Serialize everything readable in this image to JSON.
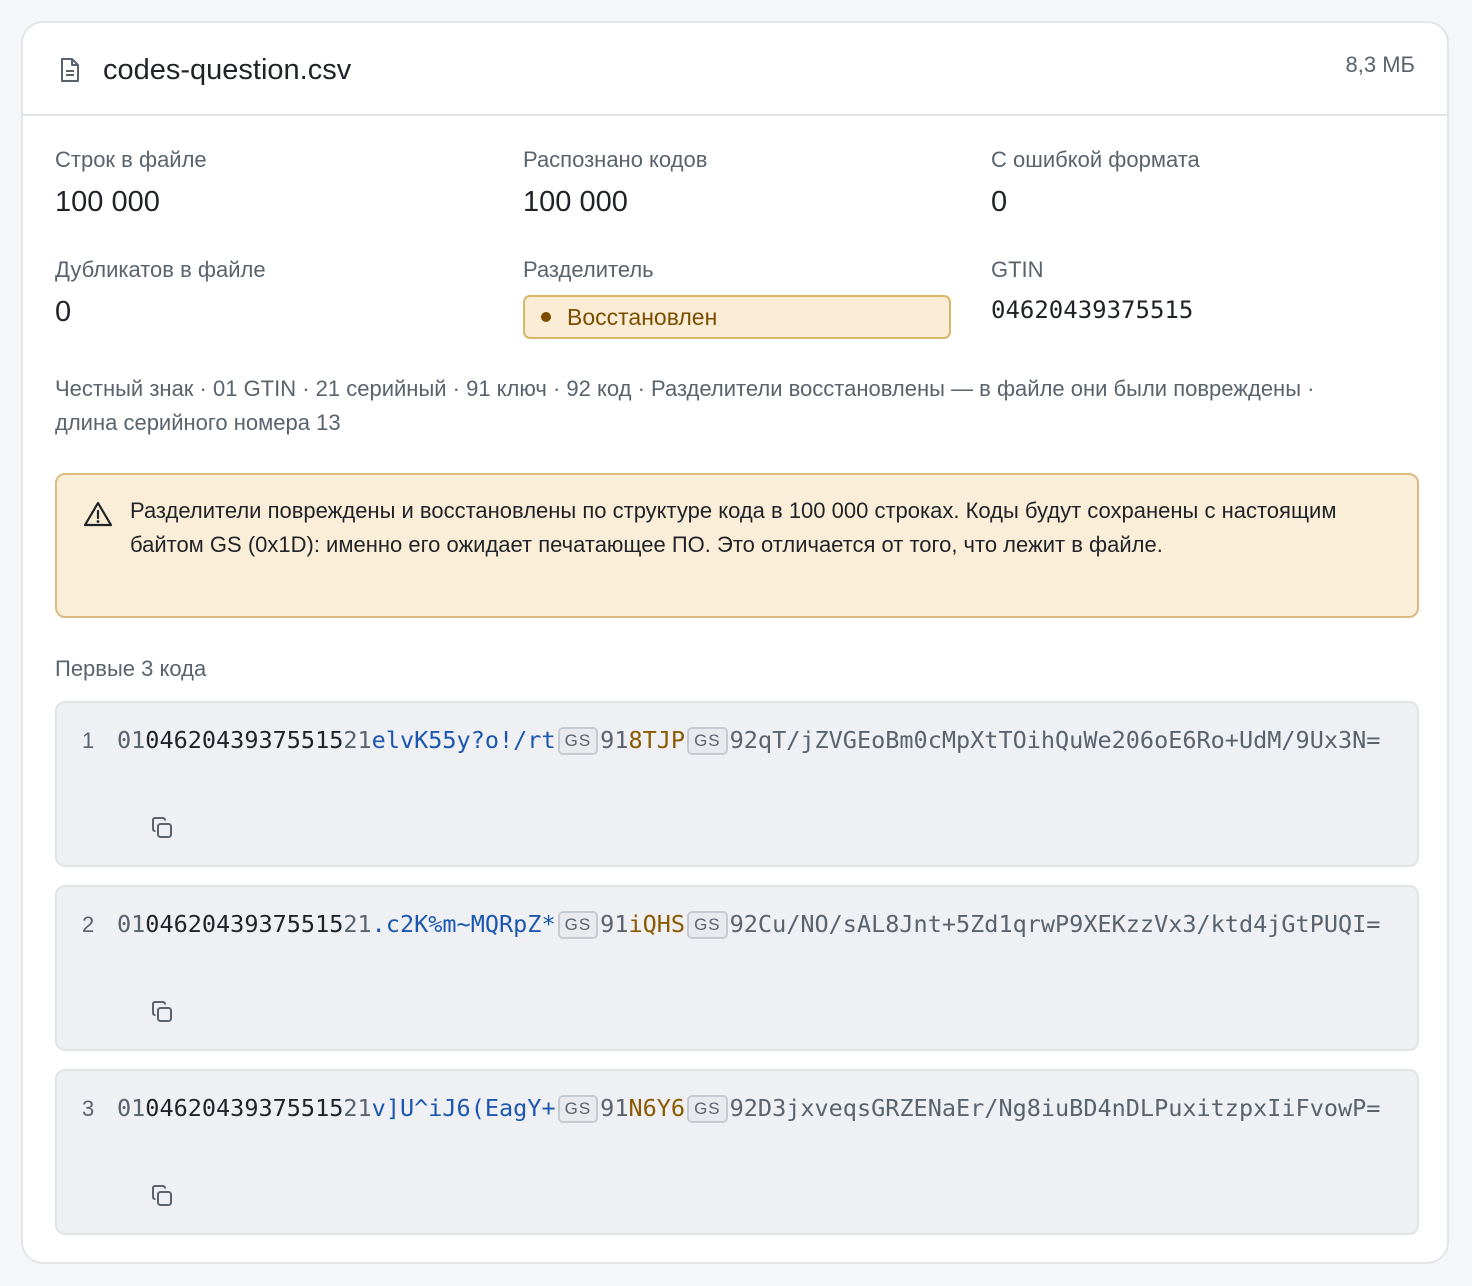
{
  "file": {
    "name": "codes-question.csv",
    "size": "8,3 МБ",
    "icon": "file-text-icon"
  },
  "stats": {
    "rows_label": "Строк в файле",
    "rows_value": "100 000",
    "recognized_label": "Распознано кодов",
    "recognized_value": "100 000",
    "format_errors_label": "С ошибкой формата",
    "format_errors_value": "0",
    "duplicates_label": "Дубликатов в файле",
    "duplicates_value": "0",
    "separator_label": "Разделитель",
    "separator_badge": "Восстановлен",
    "gtin_label": "GTIN",
    "gtin_value": "04620439375515"
  },
  "meta_line": "Честный знак · 01 GTIN · 21 серийный · 91 ключ · 92 код · Разделители восстановлены — в файле они были повреждены · длина серийного номера 13",
  "warning": {
    "icon": "warning-triangle-icon",
    "text": "Разделители повреждены и восстановлены по структуре кода в 100 000 строках. Коды будут сохранены с настоящим байтом GS (0x1D): именно его ожидает печатающее ПО. Это отличается от того, что лежит в файле."
  },
  "codes_section_title": "Первые 3 кода",
  "gs_label": "GS",
  "codes": [
    {
      "index": "1",
      "ai01": "01",
      "gtin": "04620439375515",
      "ai21": "21",
      "serial": "elvK55y?o!/rt",
      "ai91": "91",
      "key": "8TJP",
      "ai92": "92",
      "crypto": "qT/jZVGEoBm0cMpXtTOihQuWe206oE6Ro+UdM/9Ux3N="
    },
    {
      "index": "2",
      "ai01": "01",
      "gtin": "04620439375515",
      "ai21": "21",
      "serial": ".c2K%m~MQRpZ*",
      "ai91": "91",
      "key": "iQHS",
      "ai92": "92",
      "crypto": "Cu/NO/sAL8Jnt+5Zd1qrwP9XEKzzVx3/ktd4jGtPUQI="
    },
    {
      "index": "3",
      "ai01": "01",
      "gtin": "04620439375515",
      "ai21": "21",
      "serial": "v]U^iJ6(EagY+",
      "ai91": "91",
      "key": "N6Y6",
      "ai92": "92",
      "crypto": "D3jxveqsGRZENaEr/Ng8iuBD4nDLPuxitzpxIiFvowP="
    }
  ],
  "colors": {
    "serial": "#1b57b0",
    "key": "#8a5a00",
    "warning_bg": "#fbeed8",
    "badge_text": "#7a4d00"
  }
}
